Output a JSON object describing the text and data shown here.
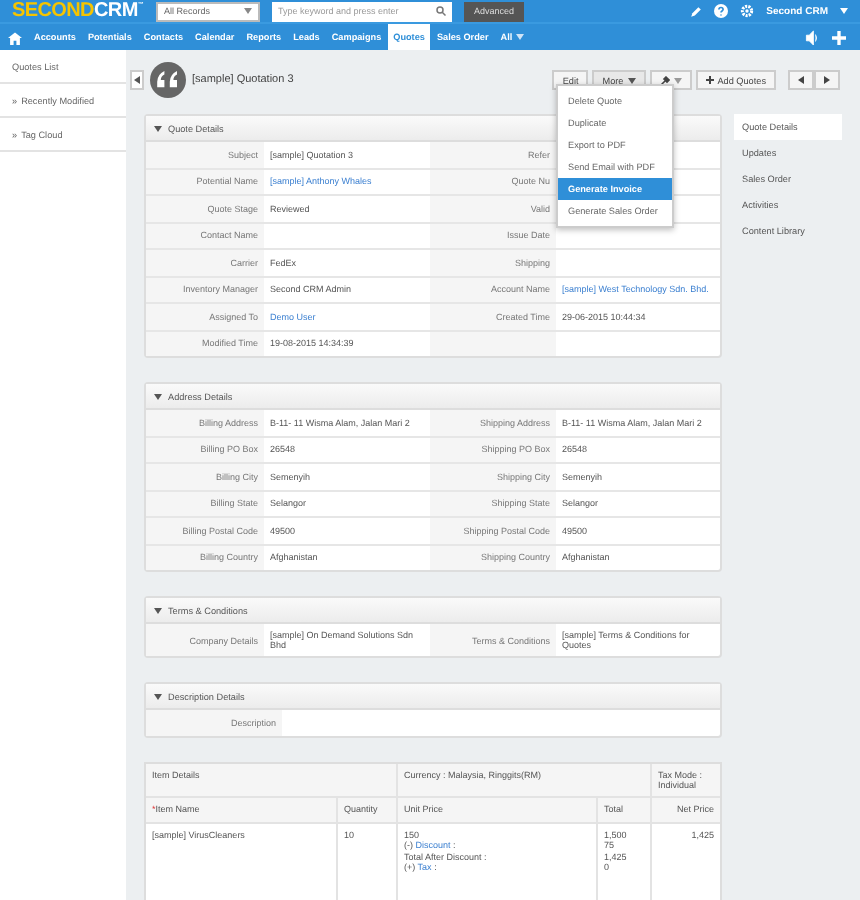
{
  "header": {
    "logo": {
      "primary": "SECOND",
      "secondary": "CRM",
      "mark": "™"
    },
    "scope": "All Records",
    "search_placeholder": "Type keyword and press enter",
    "advanced": "Advanced",
    "user": "Second CRM"
  },
  "nav": [
    {
      "label": "Accounts",
      "selected": false
    },
    {
      "label": "Potentials",
      "selected": false
    },
    {
      "label": "Contacts",
      "selected": false
    },
    {
      "label": "Calendar",
      "selected": false
    },
    {
      "label": "Reports",
      "selected": false
    },
    {
      "label": "Leads",
      "selected": false
    },
    {
      "label": "Campaigns",
      "selected": false
    },
    {
      "label": "Quotes",
      "selected": true
    },
    {
      "label": "Sales Order",
      "selected": false
    },
    {
      "label": "All",
      "selected": false
    }
  ],
  "sidebar": [
    {
      "label": "Quotes List"
    },
    {
      "label": "Recently Modified",
      "bullet": "»"
    },
    {
      "label": "Tag Cloud",
      "bullet": "»"
    }
  ],
  "record": {
    "title": "[sample] Quotation 3",
    "actions": [
      "Edit",
      "More",
      "Add Quotes"
    ]
  },
  "more_menu": [
    {
      "label": "Delete Quote",
      "selected": false
    },
    {
      "label": "Duplicate",
      "selected": false
    },
    {
      "label": "Export to PDF",
      "selected": false
    },
    {
      "label": "Send Email with PDF",
      "selected": false
    },
    {
      "label": "Generate Invoice",
      "selected": true
    },
    {
      "label": "Generate Sales Order",
      "selected": false
    }
  ],
  "sections": [
    {
      "title": "Quote Details",
      "rows": [
        [
          {
            "label": "Subject",
            "value": "[sample] Quotation 3"
          },
          {
            "label": "Refer"
          }
        ],
        [
          {
            "label": "Potential Name",
            "value": "[sample] Anthony Whales",
            "link": true
          },
          {
            "label": "Quote Nu"
          }
        ],
        [
          {
            "label": "Quote Stage",
            "value": "Reviewed"
          },
          {
            "label": "Valid"
          }
        ],
        [
          {
            "label": "Contact Name"
          },
          {
            "label": "Issue Date"
          }
        ],
        [
          {
            "label": "Carrier",
            "value": "FedEx"
          },
          {
            "label": "Shipping"
          }
        ],
        [
          {
            "label": "Inventory Manager",
            "value": "Second CRM Admin"
          },
          {
            "label": "Account Name",
            "value": "[sample] West Technology Sdn. Bhd.",
            "link": true
          }
        ],
        [
          {
            "label": "Assigned To",
            "value": "Demo User",
            "link": true
          },
          {
            "label": "Created Time",
            "value": "29-06-2015 10:44:34"
          }
        ],
        [
          {
            "label": "Modified Time",
            "value": "19-08-2015 14:34:39"
          },
          {}
        ]
      ]
    },
    {
      "title": "Address Details",
      "rows": [
        [
          {
            "label": "Billing Address",
            "value": "B-11- 11 Wisma Alam, Jalan Mari 2"
          },
          {
            "label": "Shipping Address",
            "value": "B-11- 11 Wisma Alam, Jalan Mari 2"
          }
        ],
        [
          {
            "label": "Billing PO Box",
            "value": "26548"
          },
          {
            "label": "Shipping PO Box",
            "value": "26548"
          }
        ],
        [
          {
            "label": "Billing City",
            "value": "Semenyih"
          },
          {
            "label": "Shipping City",
            "value": "Semenyih"
          }
        ],
        [
          {
            "label": "Billing State",
            "value": "Selangor"
          },
          {
            "label": "Shipping State",
            "value": "Selangor"
          }
        ],
        [
          {
            "label": "Billing Postal Code",
            "value": "49500"
          },
          {
            "label": "Shipping Postal Code",
            "value": "49500"
          }
        ],
        [
          {
            "label": "Billing Country",
            "value": "Afghanistan"
          },
          {
            "label": "Shipping Country",
            "value": "Afghanistan"
          }
        ]
      ]
    },
    {
      "title": "Terms & Conditions",
      "rows": [
        [
          {
            "label": "Company Details",
            "value": "[sample] On Demand Solutions Sdn Bhd"
          },
          {
            "label": "Terms & Conditions",
            "value": "[sample] Terms & Conditions for Quotes"
          }
        ]
      ]
    },
    {
      "title": "Description Details",
      "rows": [
        [
          {
            "label": "Description"
          }
        ]
      ]
    }
  ],
  "items": {
    "heading": "Item Details",
    "currency": "Currency : Malaysia, Ringgits(RM)",
    "tax_mode": "Tax Mode : Individual",
    "columns": [
      {
        "label": "Item Name",
        "required_mark": "*"
      },
      {
        "label": "Quantity"
      },
      {
        "label": "Unit Price"
      },
      {
        "label": "Total"
      },
      {
        "label": "Net Price"
      }
    ],
    "rows": [
      {
        "name": "[sample] VirusCleaners",
        "quantity": "10",
        "unit_price": "150",
        "discount_prefix": "(-)",
        "discount": "Discount",
        "discount_suffix": ":",
        "after_discount": "Total After Discount :",
        "tax_prefix": "(+)",
        "tax": "Tax",
        "tax_suffix": ":",
        "totals": [
          "1,500",
          "75",
          "1,425",
          "0"
        ],
        "net": "1,425"
      }
    ]
  },
  "right_tabs": [
    {
      "label": "Quote Details",
      "selected": true
    },
    {
      "label": "Updates",
      "selected": false
    },
    {
      "label": "Sales Order",
      "selected": false
    },
    {
      "label": "Activities",
      "selected": false
    },
    {
      "label": "Content Library",
      "selected": false
    }
  ]
}
